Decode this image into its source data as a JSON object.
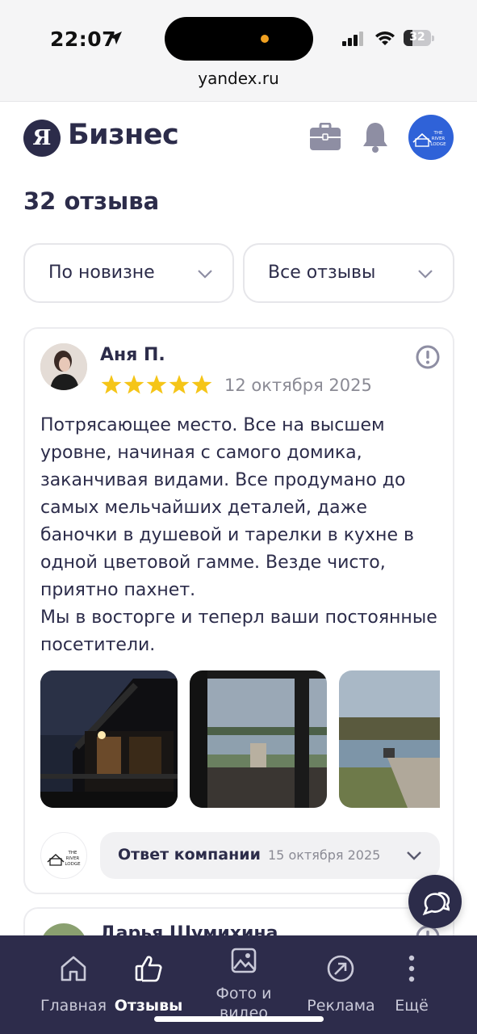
{
  "status_bar": {
    "time": "22:07",
    "battery": "32",
    "battery_level": 0.32,
    "url": "yandex.ru"
  },
  "header": {
    "logo_letter": "Я",
    "logo_text": "Бизнес",
    "company_logo_lines": [
      "THE",
      "RIVER",
      "LODGE"
    ]
  },
  "reviews_count": "32 отзыва",
  "filters": {
    "sort_label": "По новизне",
    "type_label": "Все отзывы"
  },
  "review": {
    "author": "Аня П.",
    "rating": 5,
    "date": "12 октября 2025",
    "text": "Потрясающее место. Все на высшем уровне, начиная с самого домика, заканчивая видами. Все продумано до самых мельчайших деталей, даже баночки в душевой и тарелки в кухне в одной цветовой гамме. Везде чисто, приятно пахнет.\nМы в восторге и теперл ваши постоянные посетители.",
    "reply_label": "Ответ компании",
    "reply_date": "15 октября 2025"
  },
  "review2": {
    "author": "Дарья Шумихина"
  },
  "colors": {
    "primary": "#2c2c4a",
    "star": "#f5c518",
    "company_avatar": "#2f62d8"
  },
  "bottom_nav": {
    "items": [
      {
        "label": "Главная",
        "icon": "home-icon"
      },
      {
        "label": "Отзывы",
        "icon": "thumbs-up-icon"
      },
      {
        "label": "Фото и видео",
        "icon": "photo-icon"
      },
      {
        "label": "Реклама",
        "icon": "promotion-icon"
      },
      {
        "label": "Ещё",
        "icon": "more-icon"
      }
    ],
    "active": "Отзывы"
  }
}
